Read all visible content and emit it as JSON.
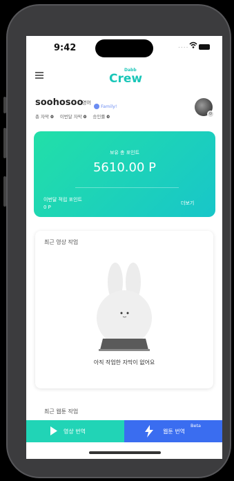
{
  "status_bar": {
    "time": "9:42",
    "signal": "....",
    "icons": [
      "wifi-icon",
      "battery-icon"
    ]
  },
  "header": {
    "logo_text": "Crew",
    "logo_badge": "Dabb"
  },
  "profile": {
    "username": "soohosoo",
    "language": "영어",
    "plan": "Family!",
    "stats": [
      {
        "label": "총 자막",
        "value": "0"
      },
      {
        "label": "이번달 자막",
        "value": "0"
      },
      {
        "label": "승인률",
        "value": "0"
      }
    ]
  },
  "points_card": {
    "title": "보유 총 포인트",
    "value": "5610.00 P",
    "month_label": "이번달 적립 포인트",
    "month_value": "0 P",
    "more_link": "더보기"
  },
  "recent_video": {
    "title": "최근 영상 작업",
    "empty_text": "아직 작업한 자막이 없어요"
  },
  "recent_webtoon": {
    "title": "최근 웹툰 작업"
  },
  "tabs": {
    "video": {
      "label": "영상 번역"
    },
    "webtoon": {
      "label": "웹툰 번역",
      "badge": "Beta"
    }
  },
  "colors": {
    "accent": "#1ac6b8",
    "card_start": "#22dfa8",
    "card_end": "#18c6c9",
    "webtoon_tab": "#3a6df0",
    "family": "#6b8cf2"
  }
}
